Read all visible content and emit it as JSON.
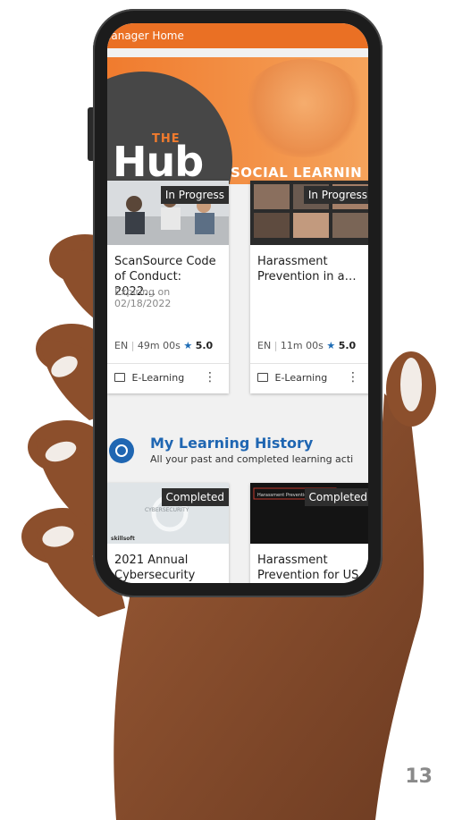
{
  "page": {
    "number": "13"
  },
  "app": {
    "title": "Manager Home"
  },
  "banner": {
    "the": "THE",
    "hub": "Hub",
    "tagline": "SOCIAL LEARNIN"
  },
  "courses": [
    {
      "status": "In Progress",
      "title": "ScanSource Code of Conduct: 2022…",
      "expiry_label": "Expiring on",
      "expiry_date": "02/18/2022",
      "language": "EN",
      "duration": "49m 00s",
      "rating": "5.0",
      "type": "E-Learning"
    },
    {
      "status": "In Progress",
      "title": "Harassment Prevention in a…",
      "language": "EN",
      "duration": "11m 00s",
      "rating": "5.0",
      "type": "E-Learning"
    }
  ],
  "history": {
    "title": "My Learning History",
    "subtitle": "All your past and completed learning acti",
    "items": [
      {
        "status": "Completed",
        "title": "2021 Annual Cybersecurity",
        "thumb_text": "CYBERSECURITY",
        "brand": "skillsoft"
      },
      {
        "status": "Completed",
        "title": "Harassment Prevention for US",
        "thumb_text": "Harassment Prevention fo"
      }
    ]
  },
  "colors": {
    "accent": "#ea7024",
    "link": "#1f66b2"
  }
}
